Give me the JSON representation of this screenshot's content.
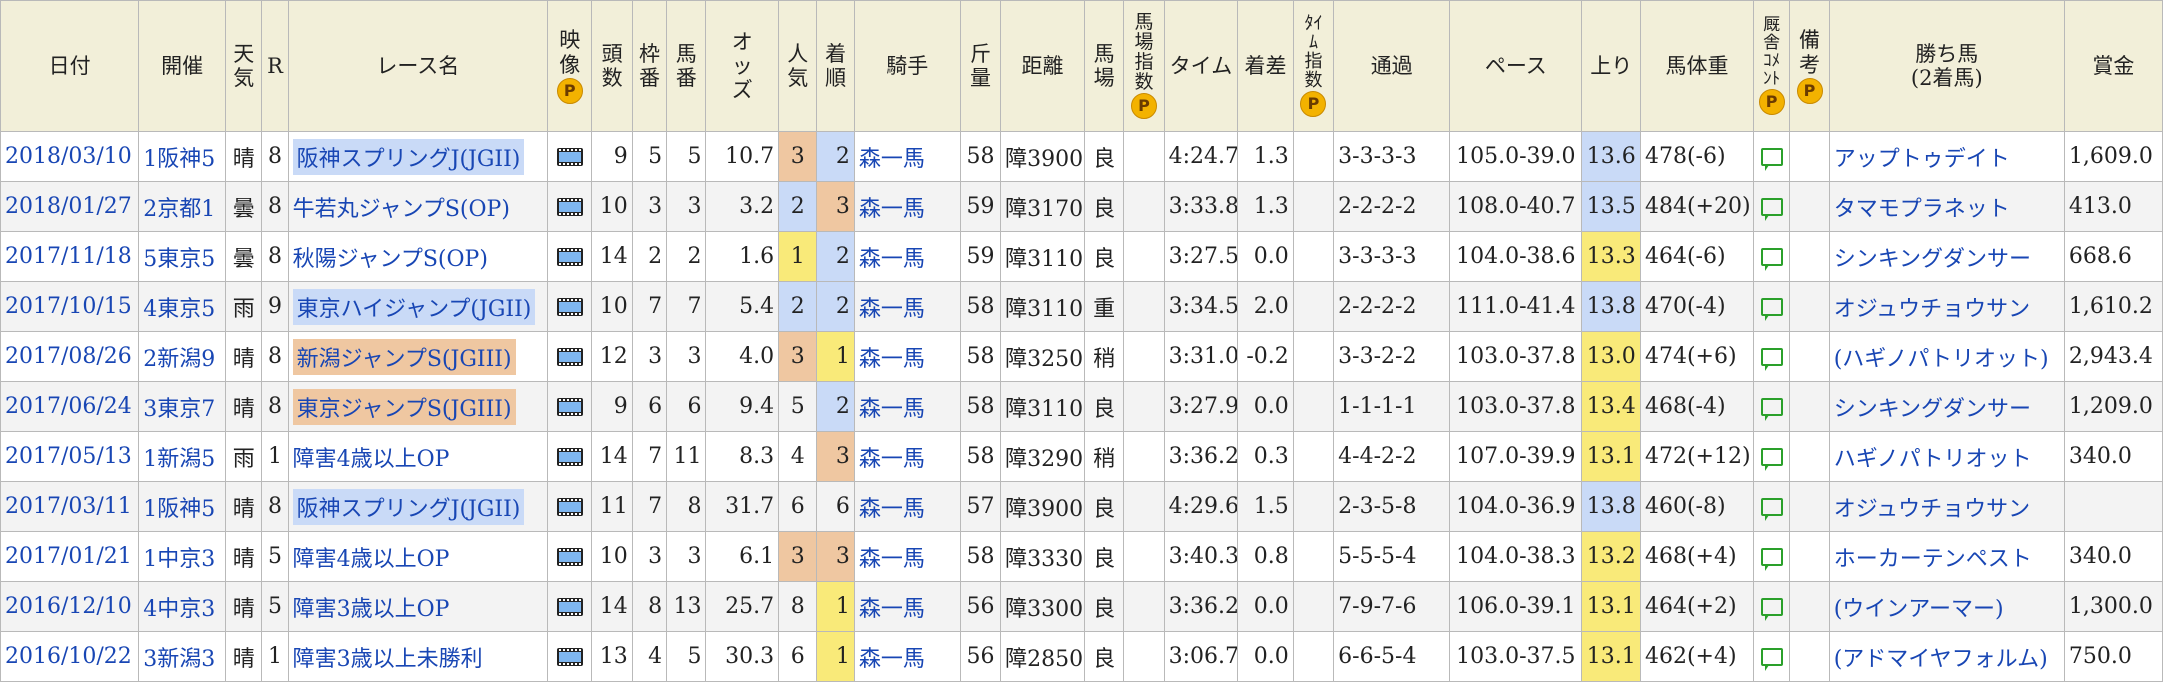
{
  "headers": {
    "date": "日付",
    "venue": "開催",
    "weather": "天\n気",
    "race_no": "R",
    "race_name": "レース名",
    "video": "映\n像",
    "heads": "頭\n数",
    "frame": "枠\n番",
    "horse_no": "馬\n番",
    "odds": "オ\nッ\nズ",
    "popularity": "人\n気",
    "finish": "着\n順",
    "jockey": "騎手",
    "weight_carried": "斤\n量",
    "distance": "距離",
    "track": "馬\n場",
    "track_index": "馬\n場\n指\n数",
    "time": "タイム",
    "margin": "着差",
    "time_index": "ﾀｲ\nﾑ\n指\n数",
    "passing": "通過",
    "pace": "ペース",
    "last3f": "上り",
    "body_weight": "馬体重",
    "stable_comment": "厩\n舎\nｺﾒ\nﾝﾄ",
    "notes": "備\n考",
    "winner": "勝ち馬\n(2着馬)",
    "prize": "賞金",
    "p_mark": "P"
  },
  "colors": {
    "header_bg": "#f2efd9",
    "link": "#1846b4",
    "grade_blue": "#c9daf7",
    "grade_orange": "#efc7a1",
    "rank_yellow": "#f9ea79"
  },
  "rows": [
    {
      "date": "2018/03/10",
      "venue": "1阪神5",
      "weather": "晴",
      "race_no": "8",
      "race_name": "阪神スプリングJ(JGII)",
      "race_hl": "blue",
      "heads": "9",
      "frame": "5",
      "horse_no": "5",
      "odds": "10.7",
      "popularity": "3",
      "pop_hl": "orange",
      "finish": "2",
      "finish_hl": "blue",
      "jockey": "森一馬",
      "weight_carried": "58",
      "distance": "障3900",
      "track": "良",
      "time": "4:24.7",
      "margin": "1.3",
      "passing": "3-3-3-3",
      "pace": "105.0-39.0",
      "last3f": "13.6",
      "last3f_hl": "blue",
      "body_weight": "478(-6)",
      "winner": "アップトゥデイト",
      "prize": "1,609.0"
    },
    {
      "date": "2018/01/27",
      "venue": "2京都1",
      "weather": "曇",
      "race_no": "8",
      "race_name": "牛若丸ジャンプS(OP)",
      "race_hl": "",
      "heads": "10",
      "frame": "3",
      "horse_no": "3",
      "odds": "3.2",
      "popularity": "2",
      "pop_hl": "blue",
      "finish": "3",
      "finish_hl": "orange",
      "jockey": "森一馬",
      "weight_carried": "59",
      "distance": "障3170",
      "track": "良",
      "time": "3:33.8",
      "margin": "1.3",
      "passing": "2-2-2-2",
      "pace": "108.0-40.7",
      "last3f": "13.5",
      "last3f_hl": "blue",
      "body_weight": "484(+20)",
      "winner": "タマモプラネット",
      "prize": "413.0"
    },
    {
      "date": "2017/11/18",
      "venue": "5東京5",
      "weather": "曇",
      "race_no": "8",
      "race_name": "秋陽ジャンプS(OP)",
      "race_hl": "",
      "heads": "14",
      "frame": "2",
      "horse_no": "2",
      "odds": "1.6",
      "popularity": "1",
      "pop_hl": "yellow",
      "finish": "2",
      "finish_hl": "blue",
      "jockey": "森一馬",
      "weight_carried": "59",
      "distance": "障3110",
      "track": "良",
      "time": "3:27.5",
      "margin": "0.0",
      "passing": "3-3-3-3",
      "pace": "104.0-38.6",
      "last3f": "13.3",
      "last3f_hl": "yellow",
      "body_weight": "464(-6)",
      "winner": "シンキングダンサー",
      "prize": "668.6"
    },
    {
      "date": "2017/10/15",
      "venue": "4東京5",
      "weather": "雨",
      "race_no": "9",
      "race_name": "東京ハイジャンプ(JGII)",
      "race_hl": "blue",
      "heads": "10",
      "frame": "7",
      "horse_no": "7",
      "odds": "5.4",
      "popularity": "2",
      "pop_hl": "blue",
      "finish": "2",
      "finish_hl": "blue",
      "jockey": "森一馬",
      "weight_carried": "58",
      "distance": "障3110",
      "track": "重",
      "time": "3:34.5",
      "margin": "2.0",
      "passing": "2-2-2-2",
      "pace": "111.0-41.4",
      "last3f": "13.8",
      "last3f_hl": "blue",
      "body_weight": "470(-4)",
      "winner": "オジュウチョウサン",
      "prize": "1,610.2"
    },
    {
      "date": "2017/08/26",
      "venue": "2新潟9",
      "weather": "晴",
      "race_no": "8",
      "race_name": "新潟ジャンプS(JGIII)",
      "race_hl": "orange",
      "heads": "12",
      "frame": "3",
      "horse_no": "3",
      "odds": "4.0",
      "popularity": "3",
      "pop_hl": "orange",
      "finish": "1",
      "finish_hl": "yellow",
      "jockey": "森一馬",
      "weight_carried": "58",
      "distance": "障3250",
      "track": "稍",
      "time": "3:31.0",
      "margin": "-0.2",
      "passing": "3-3-2-2",
      "pace": "103.0-37.8",
      "last3f": "13.0",
      "last3f_hl": "yellow",
      "body_weight": "474(+6)",
      "winner": "(ハギノパトリオット)",
      "prize": "2,943.4"
    },
    {
      "date": "2017/06/24",
      "venue": "3東京7",
      "weather": "晴",
      "race_no": "8",
      "race_name": "東京ジャンプS(JGIII)",
      "race_hl": "orange",
      "heads": "9",
      "frame": "6",
      "horse_no": "6",
      "odds": "9.4",
      "popularity": "5",
      "pop_hl": "",
      "finish": "2",
      "finish_hl": "blue",
      "jockey": "森一馬",
      "weight_carried": "58",
      "distance": "障3110",
      "track": "良",
      "time": "3:27.9",
      "margin": "0.0",
      "passing": "1-1-1-1",
      "pace": "103.0-37.8",
      "last3f": "13.4",
      "last3f_hl": "yellow",
      "body_weight": "468(-4)",
      "winner": "シンキングダンサー",
      "prize": "1,209.0"
    },
    {
      "date": "2017/05/13",
      "venue": "1新潟5",
      "weather": "雨",
      "race_no": "1",
      "race_name": "障害4歳以上OP",
      "race_hl": "",
      "heads": "14",
      "frame": "7",
      "horse_no": "11",
      "odds": "8.3",
      "popularity": "4",
      "pop_hl": "",
      "finish": "3",
      "finish_hl": "orange",
      "jockey": "森一馬",
      "weight_carried": "58",
      "distance": "障3290",
      "track": "稍",
      "time": "3:36.2",
      "margin": "0.3",
      "passing": "4-4-2-2",
      "pace": "107.0-39.9",
      "last3f": "13.1",
      "last3f_hl": "yellow",
      "body_weight": "472(+12)",
      "winner": "ハギノパトリオット",
      "prize": "340.0"
    },
    {
      "date": "2017/03/11",
      "venue": "1阪神5",
      "weather": "晴",
      "race_no": "8",
      "race_name": "阪神スプリングJ(JGII)",
      "race_hl": "blue",
      "heads": "11",
      "frame": "7",
      "horse_no": "8",
      "odds": "31.7",
      "popularity": "6",
      "pop_hl": "",
      "finish": "6",
      "finish_hl": "",
      "jockey": "森一馬",
      "weight_carried": "57",
      "distance": "障3900",
      "track": "良",
      "time": "4:29.6",
      "margin": "1.5",
      "passing": "2-3-5-8",
      "pace": "104.0-36.9",
      "last3f": "13.8",
      "last3f_hl": "blue",
      "body_weight": "460(-8)",
      "winner": "オジュウチョウサン",
      "prize": ""
    },
    {
      "date": "2017/01/21",
      "venue": "1中京3",
      "weather": "晴",
      "race_no": "5",
      "race_name": "障害4歳以上OP",
      "race_hl": "",
      "heads": "10",
      "frame": "3",
      "horse_no": "3",
      "odds": "6.1",
      "popularity": "3",
      "pop_hl": "orange",
      "finish": "3",
      "finish_hl": "orange",
      "jockey": "森一馬",
      "weight_carried": "58",
      "distance": "障3330",
      "track": "良",
      "time": "3:40.3",
      "margin": "0.8",
      "passing": "5-5-5-4",
      "pace": "104.0-38.3",
      "last3f": "13.2",
      "last3f_hl": "yellow",
      "body_weight": "468(+4)",
      "winner": "ホーカーテンペスト",
      "prize": "340.0"
    },
    {
      "date": "2016/12/10",
      "venue": "4中京3",
      "weather": "晴",
      "race_no": "5",
      "race_name": "障害3歳以上OP",
      "race_hl": "",
      "heads": "14",
      "frame": "8",
      "horse_no": "13",
      "odds": "25.7",
      "popularity": "8",
      "pop_hl": "",
      "finish": "1",
      "finish_hl": "yellow",
      "jockey": "森一馬",
      "weight_carried": "56",
      "distance": "障3300",
      "track": "良",
      "time": "3:36.2",
      "margin": "0.0",
      "passing": "7-9-7-6",
      "pace": "106.0-39.1",
      "last3f": "13.1",
      "last3f_hl": "yellow",
      "body_weight": "464(+2)",
      "winner": "(ウインアーマー)",
      "prize": "1,300.0"
    },
    {
      "date": "2016/10/22",
      "venue": "3新潟3",
      "weather": "晴",
      "race_no": "1",
      "race_name": "障害3歳以上未勝利",
      "race_hl": "",
      "heads": "13",
      "frame": "4",
      "horse_no": "5",
      "odds": "30.3",
      "popularity": "6",
      "pop_hl": "",
      "finish": "1",
      "finish_hl": "yellow",
      "jockey": "森一馬",
      "weight_carried": "56",
      "distance": "障2850",
      "track": "良",
      "time": "3:06.7",
      "margin": "0.0",
      "passing": "6-6-5-4",
      "pace": "103.0-37.5",
      "last3f": "13.1",
      "last3f_hl": "yellow",
      "body_weight": "462(+4)",
      "winner": "(アドマイヤフォルム)",
      "prize": "750.0"
    }
  ]
}
